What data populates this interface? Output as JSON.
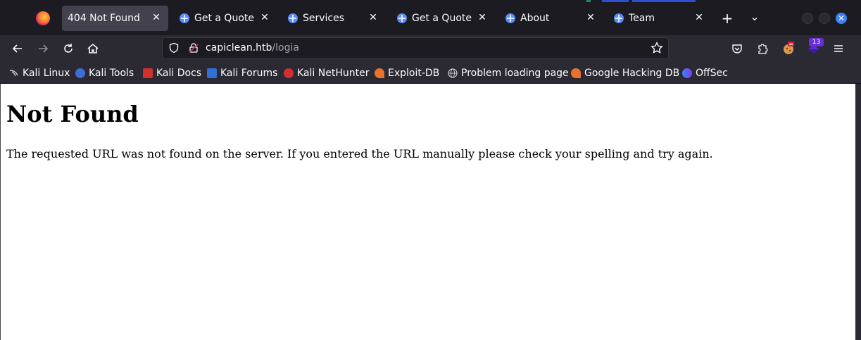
{
  "tabs": [
    {
      "title": "404 Not Found",
      "active": true
    },
    {
      "title": "Get a Quote"
    },
    {
      "title": "Services"
    },
    {
      "title": "Get a Quote"
    },
    {
      "title": "About"
    },
    {
      "title": "Team"
    }
  ],
  "tab_close_glyph": "✕",
  "new_tab_glyph": "+",
  "list_tabs_glyph": "⌄",
  "window_close_glyph": "✕",
  "url": {
    "host": "capiclean.htb",
    "path": "/logia"
  },
  "extension_badge": "13",
  "bookmarks": [
    {
      "label": "Kali Linux",
      "icon": "kali-dragon-icon",
      "color": "#cfcfd8"
    },
    {
      "label": "Kali Tools",
      "icon": "kali-tools-icon",
      "color": "#3b6fd6"
    },
    {
      "label": "Kali Docs",
      "icon": "kali-docs-icon",
      "color": "#d32f2f"
    },
    {
      "label": "Kali Forums",
      "icon": "kali-forums-icon",
      "color": "#2f6fd6"
    },
    {
      "label": "Kali NetHunter",
      "icon": "nethunter-icon",
      "color": "#d32f2f"
    },
    {
      "label": "Exploit-DB",
      "icon": "exploit-db-icon",
      "color": "#e8722c"
    },
    {
      "label": "Problem loading page",
      "icon": "globe-icon",
      "color": "#cfcfd8"
    },
    {
      "label": "Google Hacking DB",
      "icon": "ghdb-icon",
      "color": "#e8722c"
    },
    {
      "label": "OffSec",
      "icon": "offsec-icon",
      "color": "#3b82f6"
    }
  ],
  "page": {
    "heading": "Not Found",
    "message": "The requested URL was not found on the server. If you entered the URL manually please check your spelling and try again."
  },
  "colors": {
    "accent": "#3b82f6",
    "tab_active": "#42414d",
    "toolbar": "#2b2a33",
    "frame": "#1c1b22"
  }
}
